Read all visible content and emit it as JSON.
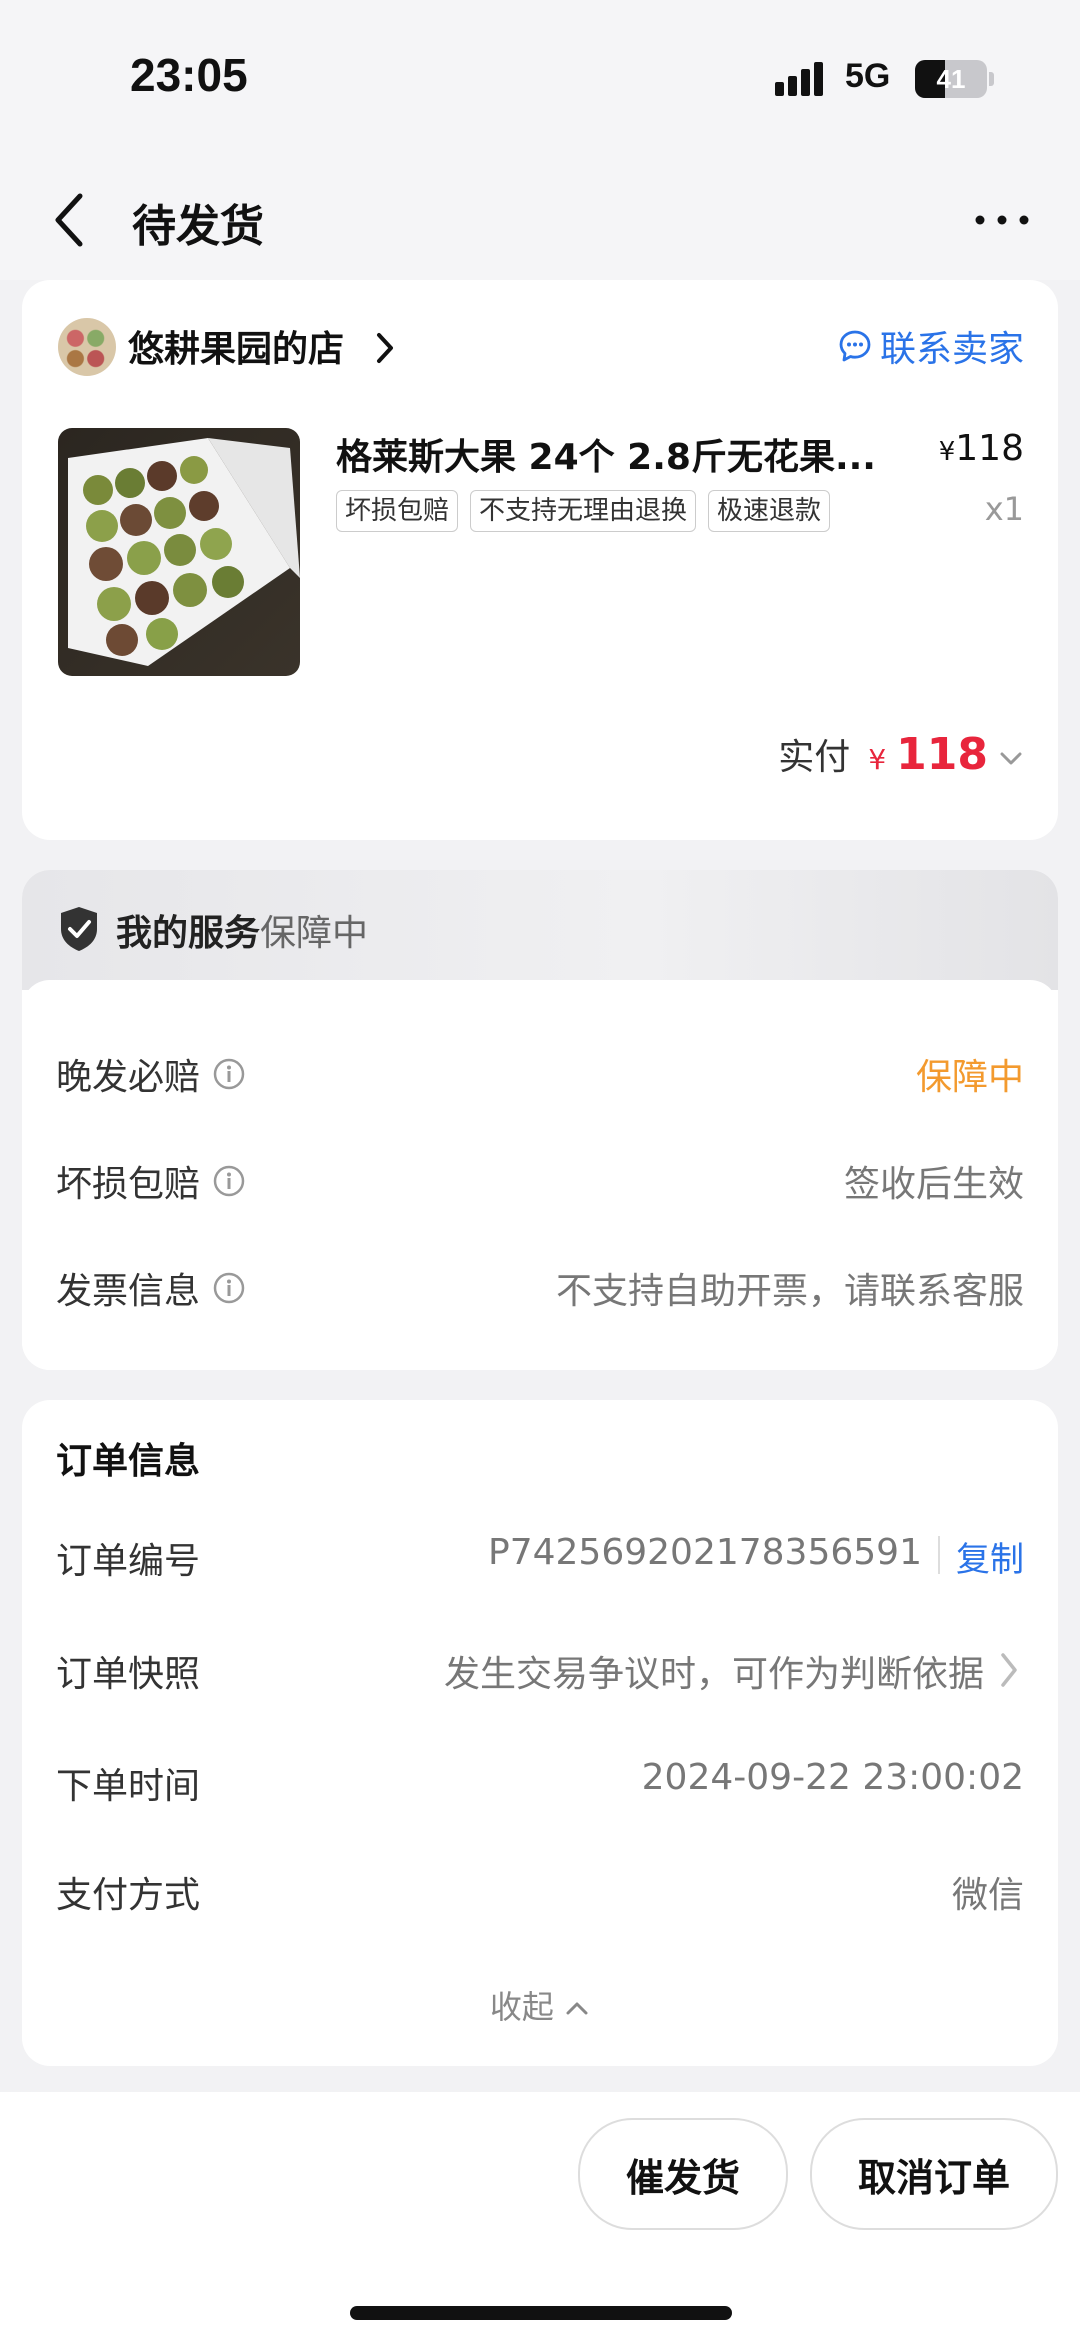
{
  "status_bar": {
    "time": "23:05",
    "network": "5G",
    "battery_level": 41,
    "battery_label": "41"
  },
  "nav": {
    "title": "待发货",
    "back_icon": "chevron-left-icon",
    "more_icon": "more-horizontal-icon"
  },
  "shop": {
    "name": "悠耕果园的店",
    "contact_label": "联系卖家"
  },
  "product": {
    "title": "格莱斯大果 24个 2.8斤无花果...",
    "price_symbol": "¥",
    "price": "118",
    "quantity": "x1",
    "tags": [
      "坏损包赔",
      "不支持无理由退换",
      "极速退款"
    ]
  },
  "payment": {
    "label": "实付",
    "currency": "¥",
    "amount": "118"
  },
  "service": {
    "title": "我的服务",
    "status": "保障中",
    "rows": [
      {
        "label": "晚发必赔",
        "value": "保障中"
      },
      {
        "label": "坏损包赔",
        "value": "签收后生效"
      },
      {
        "label": "发票信息",
        "value": "不支持自助开票，请联系客服"
      }
    ]
  },
  "order": {
    "title": "订单信息",
    "rows": [
      {
        "label": "订单编号",
        "value": "P742569202178356591"
      },
      {
        "label": "订单快照",
        "value": "发生交易争议时，可作为判断依据"
      },
      {
        "label": "下单时间",
        "value": "2024-09-22 23:00:02"
      },
      {
        "label": "支付方式",
        "value": "微信"
      }
    ],
    "copy_label": "复制",
    "collapse_label": "收起"
  },
  "actions": {
    "urge_label": "催发货",
    "cancel_label": "取消订单"
  },
  "colors": {
    "accent_blue": "#2a73e8",
    "price_red": "#e8253c",
    "status_orange": "#f39a2e"
  }
}
